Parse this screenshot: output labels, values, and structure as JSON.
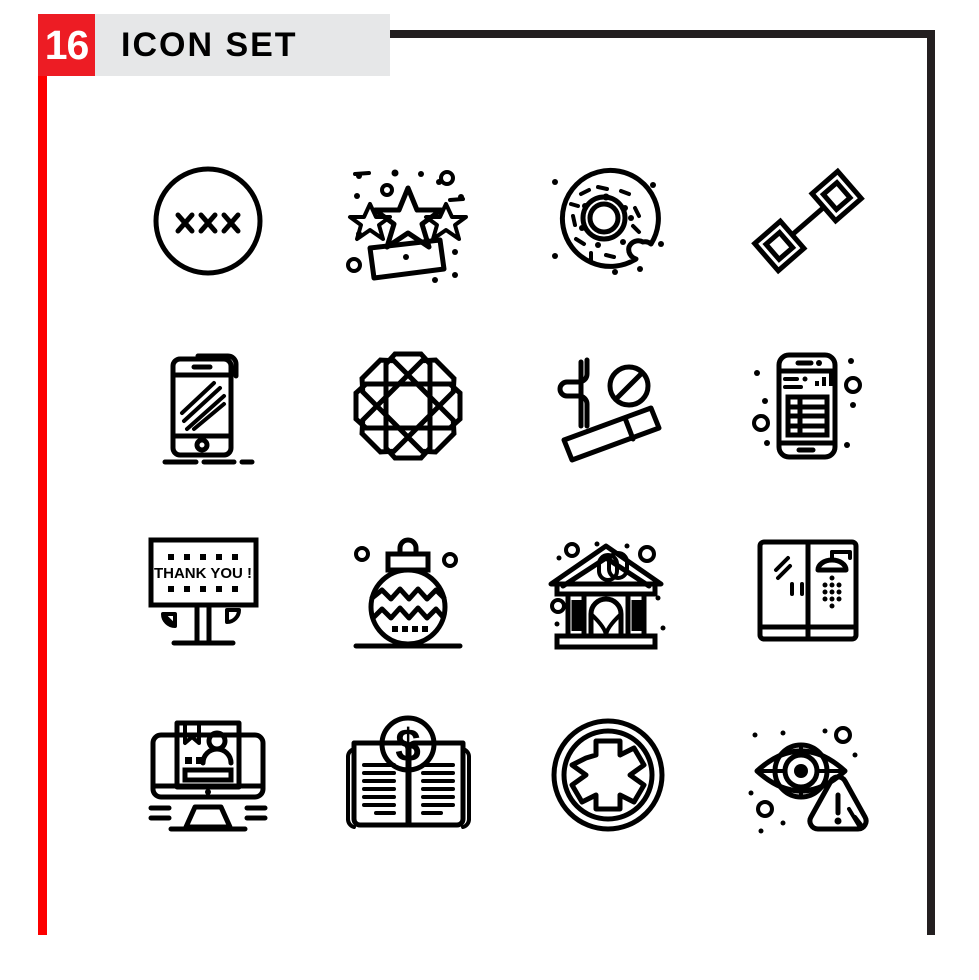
{
  "header": {
    "count": "16",
    "title": "ICON SET",
    "count_bg": "#ed1c24",
    "title_bg": "#e6e7e8",
    "title_color": "#000000"
  },
  "frame": {
    "left_border_color": "#fd0000",
    "top_border_color": "#231f20",
    "right_border_color": "#231f20"
  },
  "grid": {
    "columns": 4,
    "rows": 4,
    "stroke_color": "#000000",
    "background": "#ffffff"
  },
  "icons": [
    {
      "index": 1,
      "name": "xxx-circle-icon",
      "label": "Circle with three X marks"
    },
    {
      "index": 2,
      "name": "stars-confetti-icon",
      "label": "Three stars with confetti and banner"
    },
    {
      "index": 3,
      "name": "donut-icon",
      "label": "Donut with sprinkles and bite"
    },
    {
      "index": 4,
      "name": "dumbbell-icon",
      "label": "Diagonal dumbbell barbell"
    },
    {
      "index": 5,
      "name": "smartphone-shine-icon",
      "label": "Smartphone with shine lines"
    },
    {
      "index": 6,
      "name": "geometric-flower-icon",
      "label": "Geometric rosette flower"
    },
    {
      "index": 7,
      "name": "no-smoking-icon",
      "label": "Cigarette with prohibition sign"
    },
    {
      "index": 8,
      "name": "mobile-table-icon",
      "label": "Smartphone showing data table"
    },
    {
      "index": 9,
      "name": "thank-you-billboard-icon",
      "label": "Billboard sign",
      "billboard_text": "THANK YOU !"
    },
    {
      "index": 10,
      "name": "christmas-ornament-icon",
      "label": "Christmas ball ornament"
    },
    {
      "index": 11,
      "name": "theater-building-icon",
      "label": "Theater building with masks"
    },
    {
      "index": 12,
      "name": "shower-cabin-icon",
      "label": "Shower cabin cubicle"
    },
    {
      "index": 13,
      "name": "monitor-resume-icon",
      "label": "Monitor with profile document"
    },
    {
      "index": 14,
      "name": "finance-book-icon",
      "label": "Open book with dollar sign",
      "symbol": "$"
    },
    {
      "index": 15,
      "name": "medical-cross-icon",
      "label": "Medical cross in circle"
    },
    {
      "index": 16,
      "name": "eye-warning-icon",
      "label": "Eye with warning triangle"
    }
  ]
}
